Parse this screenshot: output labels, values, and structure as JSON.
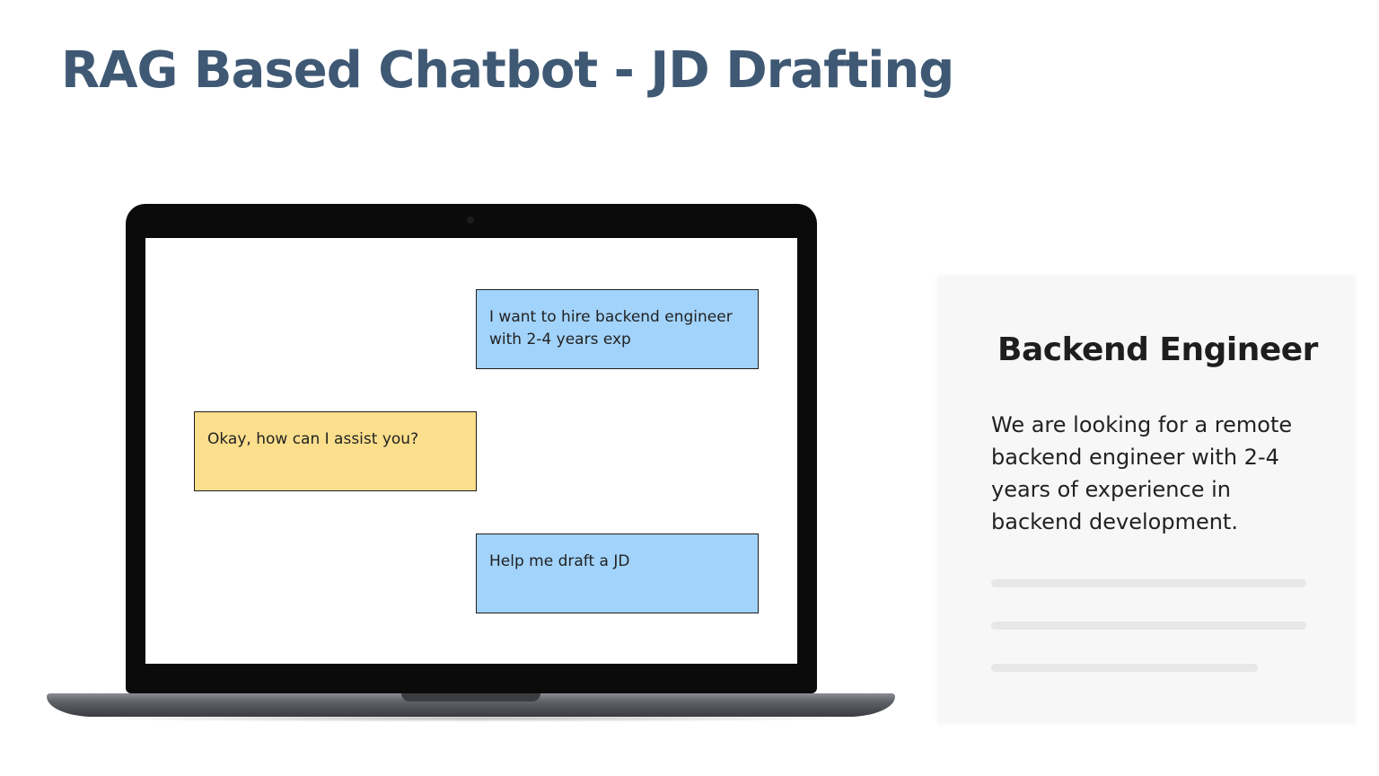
{
  "slide": {
    "title": "RAG Based Chatbot - JD Drafting"
  },
  "chat": {
    "messages": [
      {
        "role": "user",
        "text": "I want to hire backend engineer with 2-4 years exp"
      },
      {
        "role": "bot",
        "text": "Okay, how can I assist you?"
      },
      {
        "role": "user",
        "text": "Help me draft a JD"
      }
    ],
    "colors": {
      "user_bubble": "#a2d3fb",
      "bot_bubble": "#fbdf8c"
    }
  },
  "jd_card": {
    "title": "Backend Engineer",
    "body": "We are looking for a remote backend engineer with 2-4 years of experience in backend development."
  },
  "colors": {
    "title": "#3f5974"
  }
}
